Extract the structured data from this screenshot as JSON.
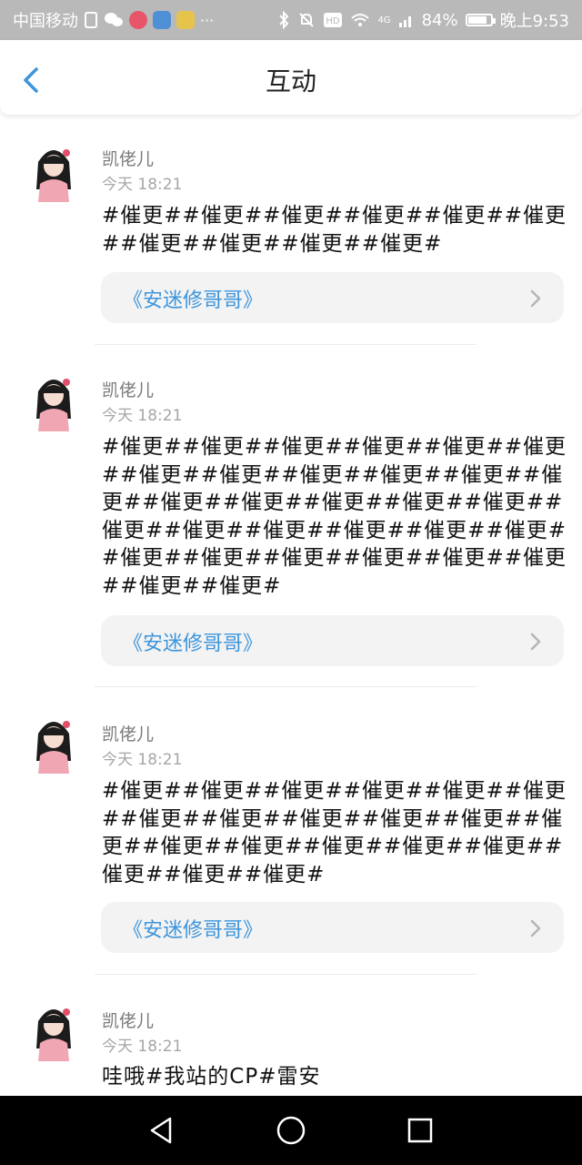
{
  "status_bar": {
    "carrier": "中国移动",
    "battery_text": "84%",
    "battery_level": 0.84,
    "time": "晚上9:53",
    "network": "4G",
    "icons": [
      "sim-icon",
      "wechat-icon",
      "app-red-icon",
      "app-blue-icon",
      "app-yellow-icon",
      "more-dots-icon",
      "bluetooth-icon",
      "mute-icon",
      "hd-icon",
      "wifi-icon",
      "signal-icon",
      "battery-icon"
    ]
  },
  "header": {
    "title": "互动",
    "back_icon": "chevron-left-icon"
  },
  "posts": [
    {
      "user": "凯佬儿",
      "time": "今天 18:21",
      "body": "#催更##催更##催更##催更##催更##催更##催更##催更##催更##催更#",
      "book": "《安迷修哥哥》"
    },
    {
      "user": "凯佬儿",
      "time": "今天 18:21",
      "body": "#催更##催更##催更##催更##催更##催更##催更##催更##催更##催更##催更##催更##催更##催更##催更##催更##催更##催更##催更##催更##催更##催更##催更##催更##催更##催更##催更##催更##催更##催更##催更#",
      "book": "《安迷修哥哥》"
    },
    {
      "user": "凯佬儿",
      "time": "今天 18:21",
      "body": "#催更##催更##催更##催更##催更##催更##催更##催更##催更##催更##催更##催更##催更##催更##催更##催更##催更##催更##催更##催更#",
      "book": "《安迷修哥哥》"
    },
    {
      "user": "凯佬儿",
      "time": "今天 18:21",
      "body": "哇哦#我站的CP#雷安"
    }
  ],
  "colors": {
    "accent": "#3d95dc",
    "status_bar": "#b9b9b9",
    "card_bg": "#f3f3f3"
  },
  "nav_bar": {
    "icons": [
      "back-triangle-icon",
      "home-circle-icon",
      "recents-square-icon"
    ]
  }
}
